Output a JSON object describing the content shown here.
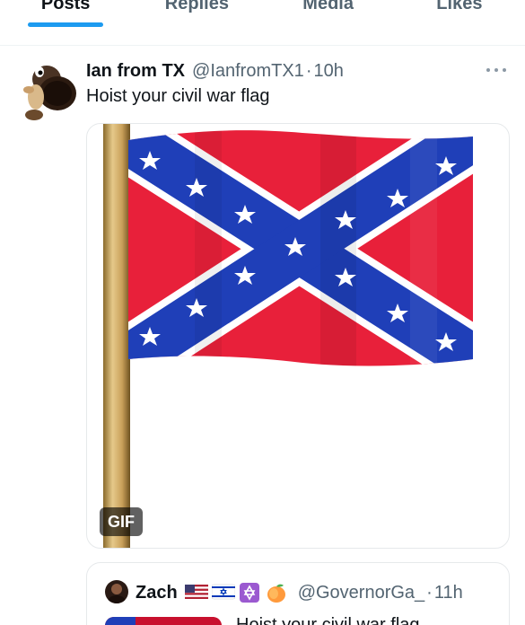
{
  "tabs": [
    {
      "label": "Posts",
      "active": true
    },
    {
      "label": "Replies",
      "active": false
    },
    {
      "label": "Media",
      "active": false
    },
    {
      "label": "Likes",
      "active": false
    }
  ],
  "tweet": {
    "display_name": "Ian from TX",
    "handle": "@IanfromTX1",
    "separator": "·",
    "time": "10h",
    "text": "Hoist your civil war flag",
    "avatar_icon": "cartoon-character-avatar",
    "more_icon": "more-options-icon",
    "media": {
      "badge": "GIF",
      "icon": "waving-flag-image"
    }
  },
  "quoted_tweet": {
    "display_name": "Zach",
    "emojis": [
      "us-flag-emoji",
      "israel-flag-emoji",
      "star-of-david-emoji",
      "peach-emoji"
    ],
    "handle": "@GovernorGa_",
    "separator": "·",
    "time": "11h",
    "text": "Hoist your civil war flag"
  },
  "colors": {
    "accent": "#1d9bf0",
    "text_primary": "#0f1419",
    "text_secondary": "#536471",
    "flag_red": "#e8203a",
    "flag_blue": "#1f3fb8"
  }
}
